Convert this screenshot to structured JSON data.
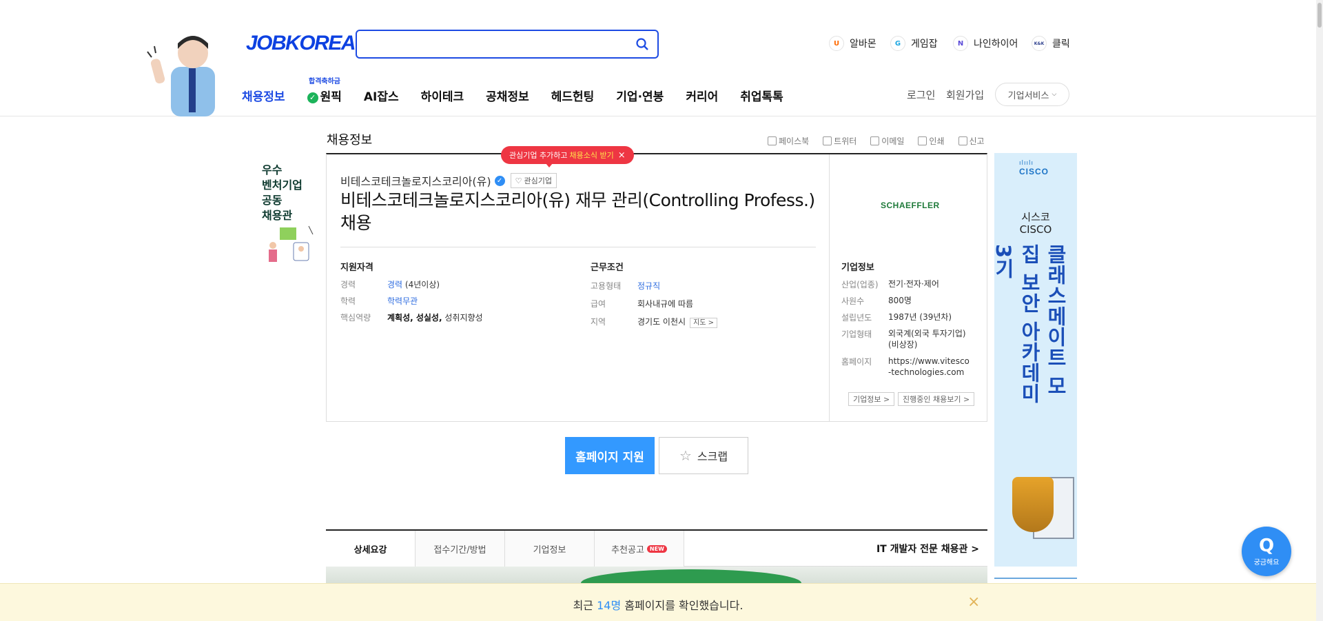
{
  "header": {
    "logo": "JOBKOREA",
    "search": {
      "placeholder": ""
    },
    "family_sites": [
      {
        "label": "알바몬",
        "icon": "albamon-icon",
        "glyph": "U",
        "color": "#ff6b00"
      },
      {
        "label": "게임잡",
        "icon": "gamejob-icon",
        "glyph": "G",
        "color": "#1ea7e1"
      },
      {
        "label": "나인하이어",
        "icon": "ninehire-icon",
        "glyph": "N",
        "color": "#5b4bd8"
      },
      {
        "label": "클릭",
        "icon": "klik-icon",
        "glyph": "K&K",
        "color": "#2c3e8c"
      }
    ],
    "gnb": [
      {
        "label": "채용정보",
        "active": true
      },
      {
        "label": "원픽",
        "badge": "합격축하금"
      },
      {
        "label": "AI잡스"
      },
      {
        "label": "하이테크"
      },
      {
        "label": "공채정보"
      },
      {
        "label": "헤드헌팅"
      },
      {
        "label": "기업·연봉"
      },
      {
        "label": "커리어"
      },
      {
        "label": "취업톡톡"
      }
    ],
    "login": "로그인",
    "signup": "회원가입",
    "corp_service": "기업서비스"
  },
  "left_banner": {
    "lines": [
      "우수",
      "벤처기업",
      "공동",
      "채용관"
    ]
  },
  "page": {
    "section_title": "채용정보",
    "share": [
      "페이스북",
      "트위터",
      "이메일",
      "인쇄",
      "신고"
    ]
  },
  "tooltip": {
    "text": "관심기업 추가하고",
    "highlight": "채용소식 받기",
    "close": "×"
  },
  "job": {
    "company": "비테스코테크놀로지스코리아(유)",
    "favorite": "관심기업",
    "title": "비테스코테크놀로지스코리아(유) 재무 관리(Controlling Profess.) 채용",
    "qualifications": {
      "heading": "지원자격",
      "experience_label": "경력",
      "experience_value": "경력",
      "experience_extra": "(4년이상)",
      "education_label": "학력",
      "education_value": "학력무관",
      "competency_label": "핵심역량",
      "competency_bold": "계획성, 성실성,",
      "competency_extra": "성취지향성"
    },
    "conditions": {
      "heading": "근무조건",
      "type_label": "고용형태",
      "type_value": "정규직",
      "salary_label": "급여",
      "salary_value": "회사내규에 따름",
      "region_label": "지역",
      "region_value": "경기도 이천시",
      "map": "지도 >"
    }
  },
  "corp_info": {
    "logo": "SCHAEFFLER",
    "heading": "기업정보",
    "rows": [
      {
        "k": "산업(업종)",
        "v": "전기·전자·제어"
      },
      {
        "k": "사원수",
        "v": "800명"
      },
      {
        "k": "설립년도",
        "v": "1987년 (39년차)"
      },
      {
        "k": "기업형태",
        "v": "외국계(외국 투자기업) (비상장)"
      },
      {
        "k": "홈페이지",
        "v": "https://www.vitesco-technologies.com"
      }
    ],
    "btn_info": "기업정보 >",
    "btn_jobs": "진행중인 채용보기 >"
  },
  "actions": {
    "apply": "홈페이지 지원",
    "scrap": "스크랩"
  },
  "tabs": {
    "items": [
      "상세요강",
      "접수기간/방법",
      "기업정보",
      "추천공고"
    ],
    "new_badge": "NEW",
    "it_link": "IT 개발자 전문 채용관 >"
  },
  "right_banner": {
    "brand": "CISCO",
    "bars": "ılıılı",
    "sub1": "시스코",
    "sub2": "CISCO",
    "vertical": "클래스메이트 모집 보안 아카데미 3기"
  },
  "help": {
    "q": "Q",
    "label": "궁금해요"
  },
  "notice": {
    "prefix": "최근",
    "count": "14명",
    "suffix": "홈페이지를 확인했습니다.",
    "close": "×"
  }
}
